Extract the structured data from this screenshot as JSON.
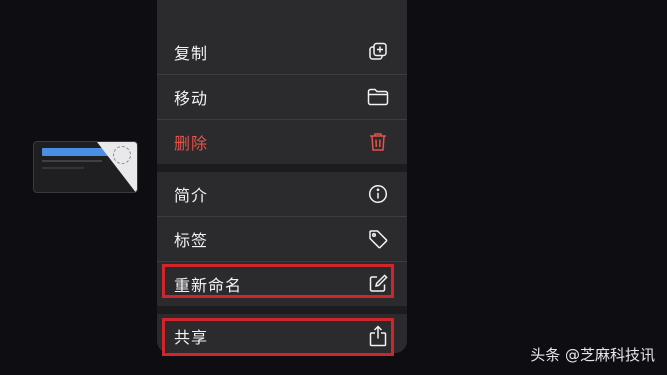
{
  "menu": {
    "items": [
      {
        "label": "复制",
        "icon": "duplicate-icon",
        "destructive": false
      },
      {
        "label": "移动",
        "icon": "folder-icon",
        "destructive": false
      },
      {
        "label": "删除",
        "icon": "trash-icon",
        "destructive": true
      },
      {
        "label": "简介",
        "icon": "info-icon",
        "destructive": false
      },
      {
        "label": "标签",
        "icon": "tag-icon",
        "destructive": false
      },
      {
        "label": "重新命名",
        "icon": "rename-icon",
        "destructive": false,
        "highlighted": true
      },
      {
        "label": "共享",
        "icon": "share-icon",
        "destructive": false,
        "highlighted": true
      }
    ]
  },
  "colors": {
    "background": "#0e0d12",
    "menu_background": "#2b2b2e",
    "destructive": "#e5534b",
    "highlight": "#d0252b",
    "text": "#f2f2f2"
  },
  "watermark": "头条 @芝麻科技讯"
}
